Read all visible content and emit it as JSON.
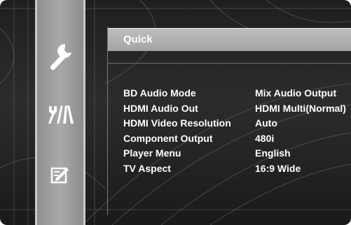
{
  "menu": {
    "title": "Quick",
    "items": [
      {
        "label": "BD Audio Mode",
        "value": "Mix Audio Output"
      },
      {
        "label": "HDMI Audio Out",
        "value": "HDMI Multi(Normal)"
      },
      {
        "label": "HDMI Video Resolution",
        "value": "Auto"
      },
      {
        "label": "Component Output",
        "value": "480i"
      },
      {
        "label": "Player Menu",
        "value": "English"
      },
      {
        "label": "TV Aspect",
        "value": "16:9 Wide"
      }
    ]
  },
  "sidebar": {
    "icons": [
      "wrench-icon",
      "tools-icon",
      "edit-icon"
    ]
  }
}
